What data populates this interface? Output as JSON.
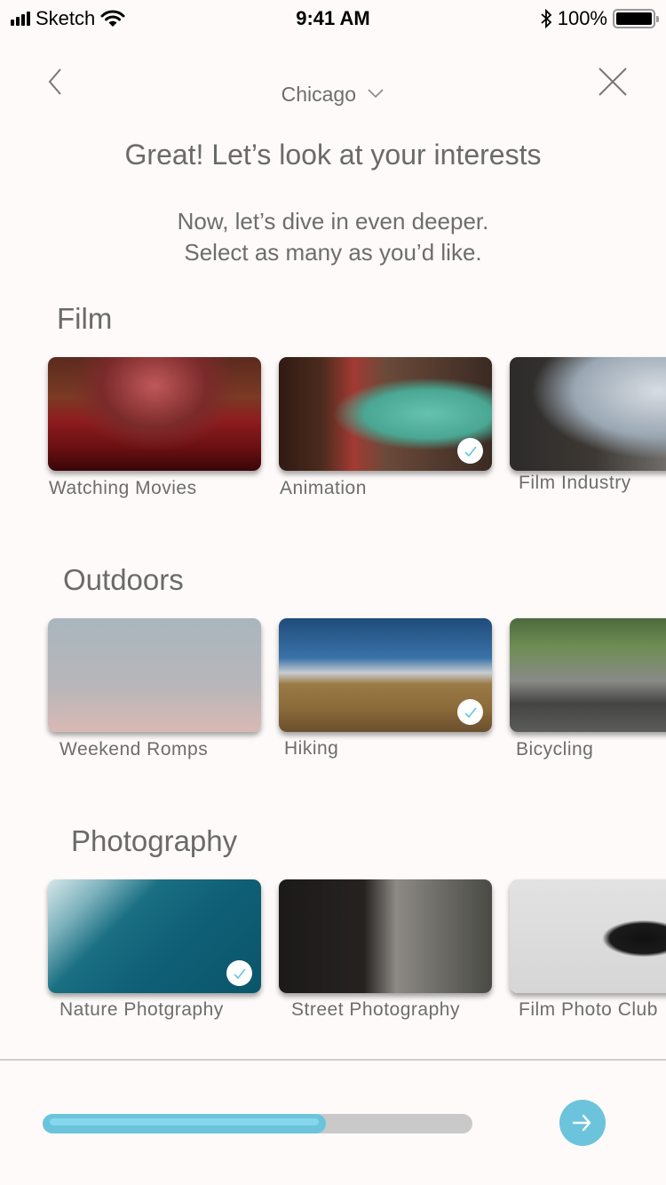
{
  "status_bar": {
    "carrier": "Sketch",
    "time": "9:41 AM",
    "battery": "100%"
  },
  "header": {
    "city": "Chicago",
    "title": "Great! Let’s look at your interests",
    "subtitle_line1": "Now, let’s dive in even deeper.",
    "subtitle_line2": "Select  as many as you’d like."
  },
  "sections": [
    {
      "title": "Film",
      "items": [
        {
          "label": "Watching  Movies",
          "selected": false,
          "image": "theater-seats-photo"
        },
        {
          "label": "Animation",
          "selected": true,
          "image": "animated-characters-photo"
        },
        {
          "label": "Film Industry",
          "selected": false,
          "image": "camera-crew-photo"
        }
      ]
    },
    {
      "title": "Outdoors",
      "items": [
        {
          "label": "Weekend Romps",
          "selected": false,
          "image": "palm-trees-photo"
        },
        {
          "label": "Hiking",
          "selected": true,
          "image": "hikers-photo"
        },
        {
          "label": "Bicycling",
          "selected": false,
          "image": "cyclists-photo"
        }
      ]
    },
    {
      "title": "Photography",
      "items": [
        {
          "label": "Nature Photgraphy",
          "selected": true,
          "image": "ocean-waves-photo"
        },
        {
          "label": "Street Photography",
          "selected": false,
          "image": "street-photographer-photo"
        },
        {
          "label": "Film Photo Club",
          "selected": false,
          "image": "vintage-camera-photo"
        }
      ]
    }
  ],
  "footer": {
    "progress_percent": 66,
    "next_icon": "arrow-right-icon"
  },
  "colors": {
    "accent": "#6bc4dc",
    "accent_light": "#86d6ee",
    "track": "#c9c9c9",
    "background": "#fdfaf9",
    "text": "#6a6a6a"
  }
}
